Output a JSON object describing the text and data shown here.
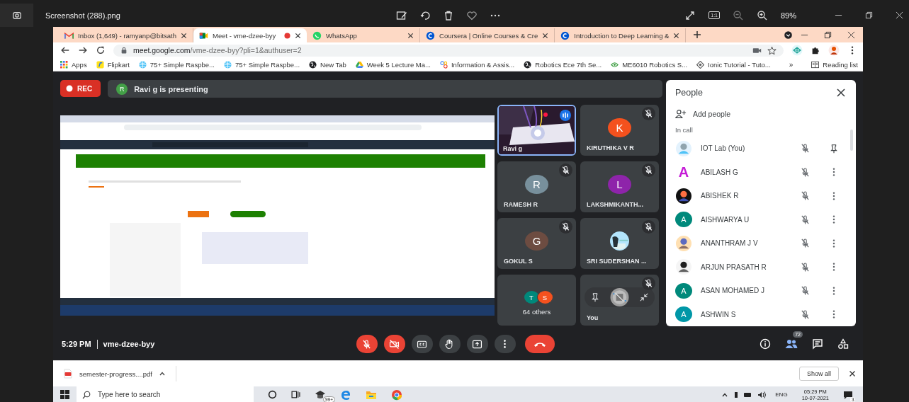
{
  "viewer": {
    "title": "Screenshot (288).png",
    "actual_size": "1:1",
    "zoom": "89%"
  },
  "browser": {
    "tabs": [
      {
        "title": "Inbox (1,649) - ramyanp@bitsath",
        "selected": false,
        "recording": false
      },
      {
        "title": "Meet - vme-dzee-byy",
        "selected": true,
        "recording": true
      },
      {
        "title": "WhatsApp",
        "selected": false,
        "recording": false
      },
      {
        "title": "Coursera | Online Courses & Cre",
        "selected": false,
        "recording": false
      },
      {
        "title": "Introduction to Deep Learning &",
        "selected": false,
        "recording": false
      }
    ],
    "url_host": "meet.google.com",
    "url_path": "/vme-dzee-byy?pli=1&authuser=2",
    "bookmarks": [
      "Apps",
      "Flipkart",
      "75+ Simple Raspbe...",
      "75+ Simple Raspbe...",
      "New Tab",
      "Week 5 Lecture Ma...",
      "Information & Assis...",
      "Robotics Ece 7th Se...",
      "ME6010 Robotics S...",
      "Ionic Tutorial - Tuto..."
    ],
    "more": "»",
    "reading_list": "Reading list"
  },
  "meet": {
    "rec": "REC",
    "presenter": {
      "initial": "R",
      "text": "Ravi g is presenting"
    },
    "tiles": [
      {
        "kind": "video",
        "name": "Ravi g",
        "speaking": true
      },
      {
        "kind": "letter",
        "name": "KIRUTHIKA V R",
        "initial": "K",
        "color": "#f4511e",
        "muted": true
      },
      {
        "kind": "letter",
        "name": "RAMESH R",
        "initial": "R",
        "color": "#78909c",
        "muted": true
      },
      {
        "kind": "letter",
        "name": "LAKSHMIKANTH...",
        "initial": "L",
        "color": "#8e24aa",
        "muted": true
      },
      {
        "kind": "letter",
        "name": "GOKUL S",
        "initial": "G",
        "color": "#6d4c41",
        "muted": true
      },
      {
        "name": "SRI SUDERSHAN ...",
        "muted": true
      },
      {
        "kind": "others",
        "text": "64 others",
        "avatars": [
          {
            "initial": "T",
            "color": "#00897b"
          },
          {
            "initial": "S",
            "color": "#f4511e"
          }
        ]
      },
      {
        "kind": "self",
        "name": "You",
        "muted": true
      }
    ],
    "people": {
      "title": "People",
      "add": "Add people",
      "section": "In call",
      "list": [
        {
          "kind": "self",
          "name": "IOT Lab (You)",
          "muted": true
        },
        {
          "kind": "member",
          "name": "ABILASH G",
          "avatar": {
            "kind": "glyph",
            "letter": "A",
            "color": "#c51bd6"
          },
          "muted": true
        },
        {
          "kind": "member",
          "name": "ABISHEK R",
          "muted": true
        },
        {
          "kind": "member",
          "name": "AISHWARYA U",
          "avatar": {
            "kind": "letter",
            "letter": "A",
            "color": "#00897b"
          },
          "muted": true
        },
        {
          "kind": "member",
          "name": "ANANTHRAM J V",
          "muted": true
        },
        {
          "kind": "member",
          "name": "ARJUN PRASATH R",
          "muted": true
        },
        {
          "kind": "member",
          "name": "ASAN MOHAMED J",
          "avatar": {
            "kind": "letter",
            "letter": "A",
            "color": "#00897b"
          },
          "muted": true
        },
        {
          "kind": "member",
          "name": "ASHWIN S",
          "avatar": {
            "kind": "letter",
            "letter": "A",
            "color": "#0097a7"
          },
          "muted": true
        }
      ]
    },
    "bar": {
      "time": "5:29 PM",
      "code": "vme-dzee-byy",
      "controls": [
        {
          "kind": "mic",
          "off": true
        },
        {
          "kind": "camera",
          "off": true
        },
        {
          "kind": "captions"
        },
        {
          "kind": "hand"
        },
        {
          "kind": "present"
        },
        {
          "kind": "more"
        },
        {
          "kind": "end"
        }
      ],
      "people_count": "72"
    }
  },
  "downloads": {
    "file": "semester-progress....pdf",
    "show_all": "Show all"
  },
  "taskbar": {
    "search": {
      "placeholder": "Type here to search"
    },
    "badge": "99+",
    "lang": "ENG",
    "time": "05:29 PM",
    "date": "10-07-2021",
    "notifications": "3"
  }
}
